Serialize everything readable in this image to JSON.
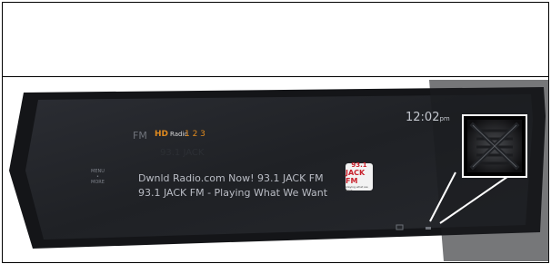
{
  "radio": {
    "band": "FM",
    "hd_logo": "HD",
    "hd_label": "Radio",
    "channels": "1 2 3",
    "ghost_text": "93.1 JACK",
    "menu_label_top": "MENU",
    "menu_label_bottom": "MORE",
    "line1": "Dwnld Radio.com Now!    93.1 JACK FM",
    "line2": "93.1 JACK FM - Playing What We Want",
    "clock_time": "12:02",
    "clock_ampm": "pm",
    "logo_freq": "93.1",
    "logo_name": "JACK FM",
    "logo_tagline": "playing what we want"
  },
  "callout": {
    "icon": "crossed-out-list-icon"
  },
  "colors": {
    "screen": "#23252a",
    "bezel": "#121316",
    "hd_accent": "#e08a1e",
    "logo_red": "#c8202b"
  }
}
